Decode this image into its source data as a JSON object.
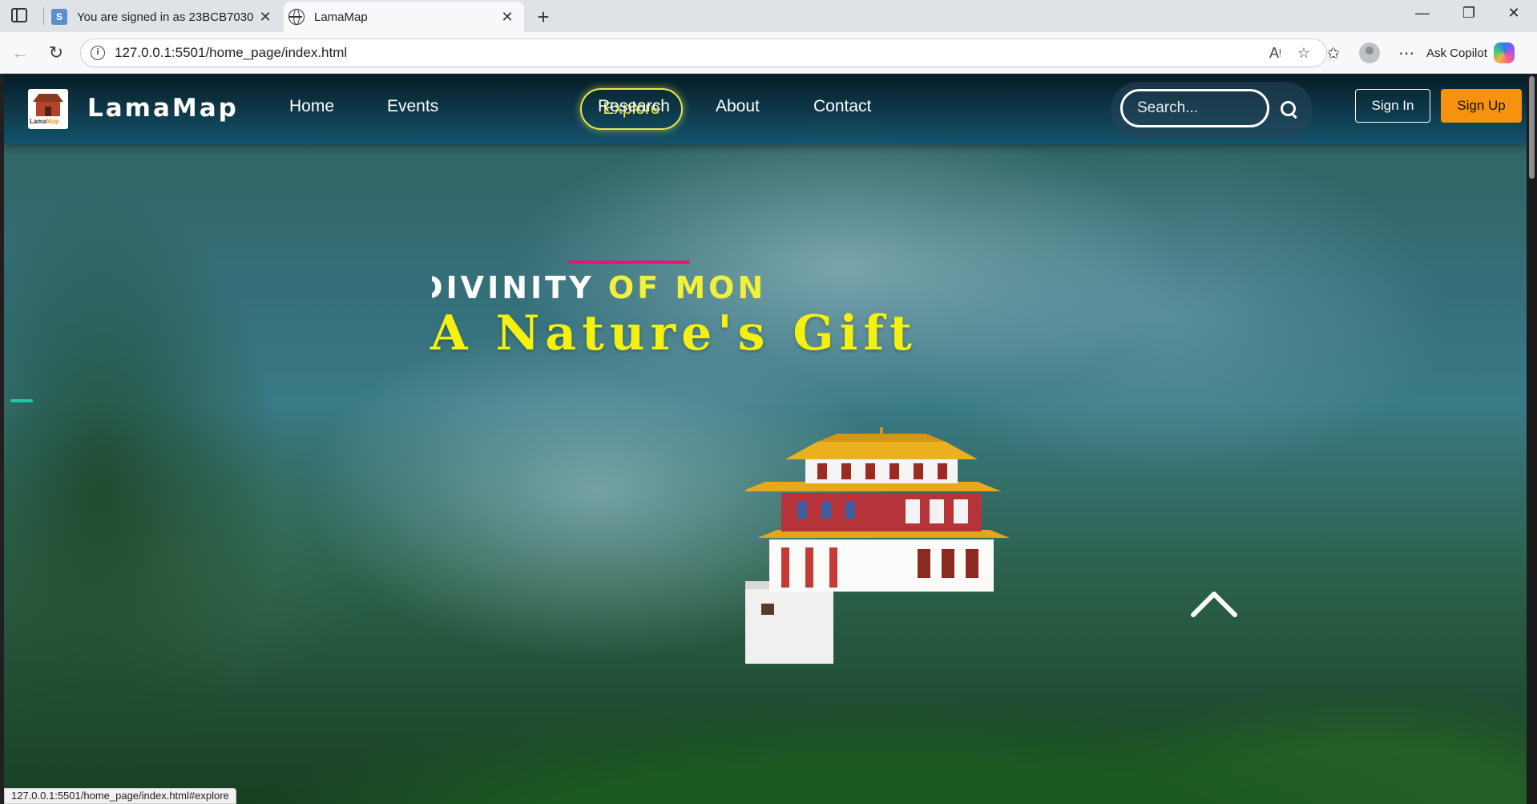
{
  "browser": {
    "tabs": [
      {
        "label": "You are signed in as 23BCB7030",
        "favicon": "s-badge-icon",
        "active": false
      },
      {
        "label": "LamaMap",
        "favicon": "globe-icon",
        "active": true
      }
    ],
    "url": "127.0.0.1:5501/home_page/index.html",
    "copilot_label": "Ask Copilot",
    "status_url": "127.0.0.1:5501/home_page/index.html#explore"
  },
  "site": {
    "logo_text": {
      "part1": "Lama",
      "part2": "Map"
    },
    "brand": "LamaMap",
    "nav": [
      "Home",
      "Events",
      "Explore",
      "Research",
      "About",
      "Contact"
    ],
    "active_nav": "Explore",
    "search": {
      "placeholder": "Search..."
    },
    "sign_in": "Sign In",
    "sign_up": "Sign Up"
  },
  "hero": {
    "typed_white": "DIVINITY ",
    "typed_highlight": "OF MONAST",
    "title": "A Nature's Gift"
  },
  "colors": {
    "accent_yellow": "#f4f00f",
    "explore_border": "#e6e94a",
    "underline_pink": "#e0196e",
    "signup_orange": "#f5930f"
  }
}
